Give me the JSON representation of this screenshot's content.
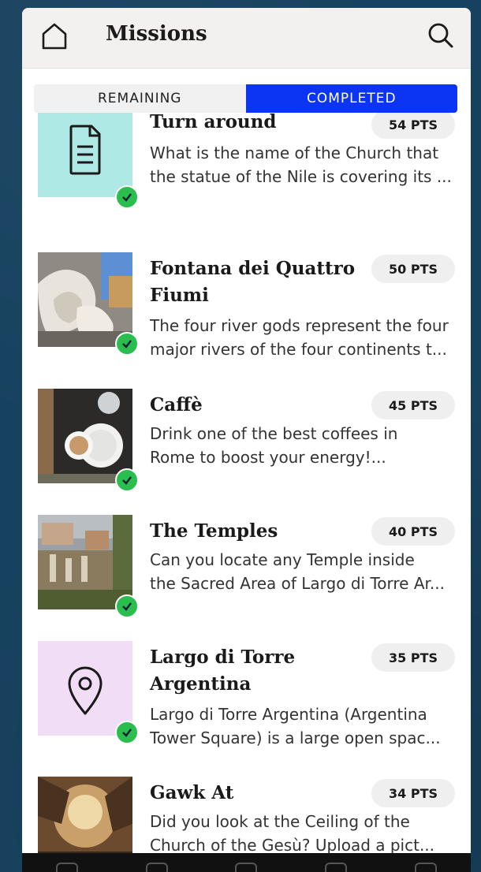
{
  "header": {
    "title": "Missions",
    "home_icon": "home-icon",
    "search_icon": "search-icon"
  },
  "tabs": {
    "remaining": "REMAINING",
    "completed": "COMPLETED",
    "active": "completed"
  },
  "colors": {
    "accent": "#0b35f2",
    "check": "#2bbd4d"
  },
  "missions": [
    {
      "name": "Turn around",
      "points": "54 PTS",
      "desc1": "What is the name of the Church that",
      "desc2": "the statue of the Nile is covering its ...",
      "thumb": "document-icon",
      "completed": true
    },
    {
      "name": "Fontana dei Quattro Fiumi",
      "points": "50 PTS",
      "desc1": "The four river gods represent the four",
      "desc2": "major rivers of the four continents t...",
      "thumb": "photo-fountain",
      "completed": true
    },
    {
      "name": "Caffè",
      "points": "45 PTS",
      "desc1": "Drink one of the best coffees in",
      "desc2": "Rome to boost your energy!...",
      "thumb": "photo-coffee",
      "completed": true
    },
    {
      "name": "The Temples",
      "points": "40 PTS",
      "desc1": "Can you locate any Temple inside",
      "desc2": "the Sacred Area of Largo di Torre Ar...",
      "thumb": "photo-temples",
      "completed": true
    },
    {
      "name": "Largo di Torre Argentina",
      "points": "35 PTS",
      "desc1": "Largo di Torre Argentina (Argentina",
      "desc2": "Tower Square) is a large open spac...",
      "thumb": "map-pin-icon",
      "completed": true
    },
    {
      "name": "Gawk At",
      "points": "34 PTS",
      "desc1": "Did you look at the Ceiling of the",
      "desc2": "Church of the Gesù? Upload a pict...",
      "thumb": "photo-ceiling",
      "completed": true
    }
  ]
}
